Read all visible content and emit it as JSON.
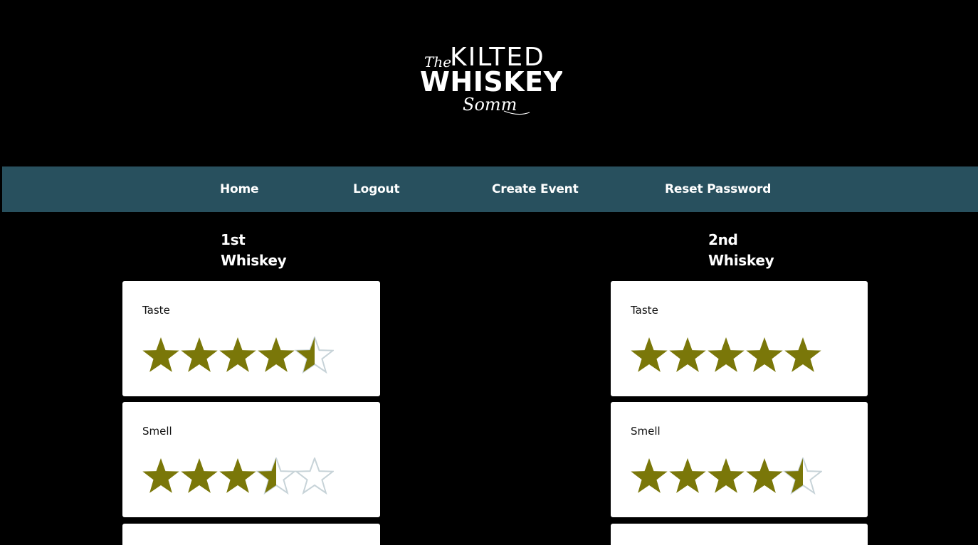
{
  "logo": {
    "line1_script": "The",
    "line1": "KILTED",
    "line2": "WHISKEY",
    "line3_script": "Somm"
  },
  "nav": {
    "home": "Home",
    "logout": "Logout",
    "create_event": "Create Event",
    "reset_password": "Reset Password"
  },
  "columns": [
    {
      "title_line1": "1st",
      "title_line2": "Whiskey",
      "ratings": [
        {
          "label": "Taste",
          "value": 4.5,
          "max": 5
        },
        {
          "label": "Smell",
          "value": 3.5,
          "max": 5
        }
      ]
    },
    {
      "title_line1": "2nd",
      "title_line2": "Whiskey",
      "ratings": [
        {
          "label": "Taste",
          "value": 5,
          "max": 5
        },
        {
          "label": "Smell",
          "value": 4.5,
          "max": 5
        }
      ]
    }
  ],
  "colors": {
    "background": "#000000",
    "nav_background": "#28505e",
    "star_filled": "#7a7709",
    "star_empty_stroke": "#c7d3d8",
    "card_background": "#ffffff"
  }
}
